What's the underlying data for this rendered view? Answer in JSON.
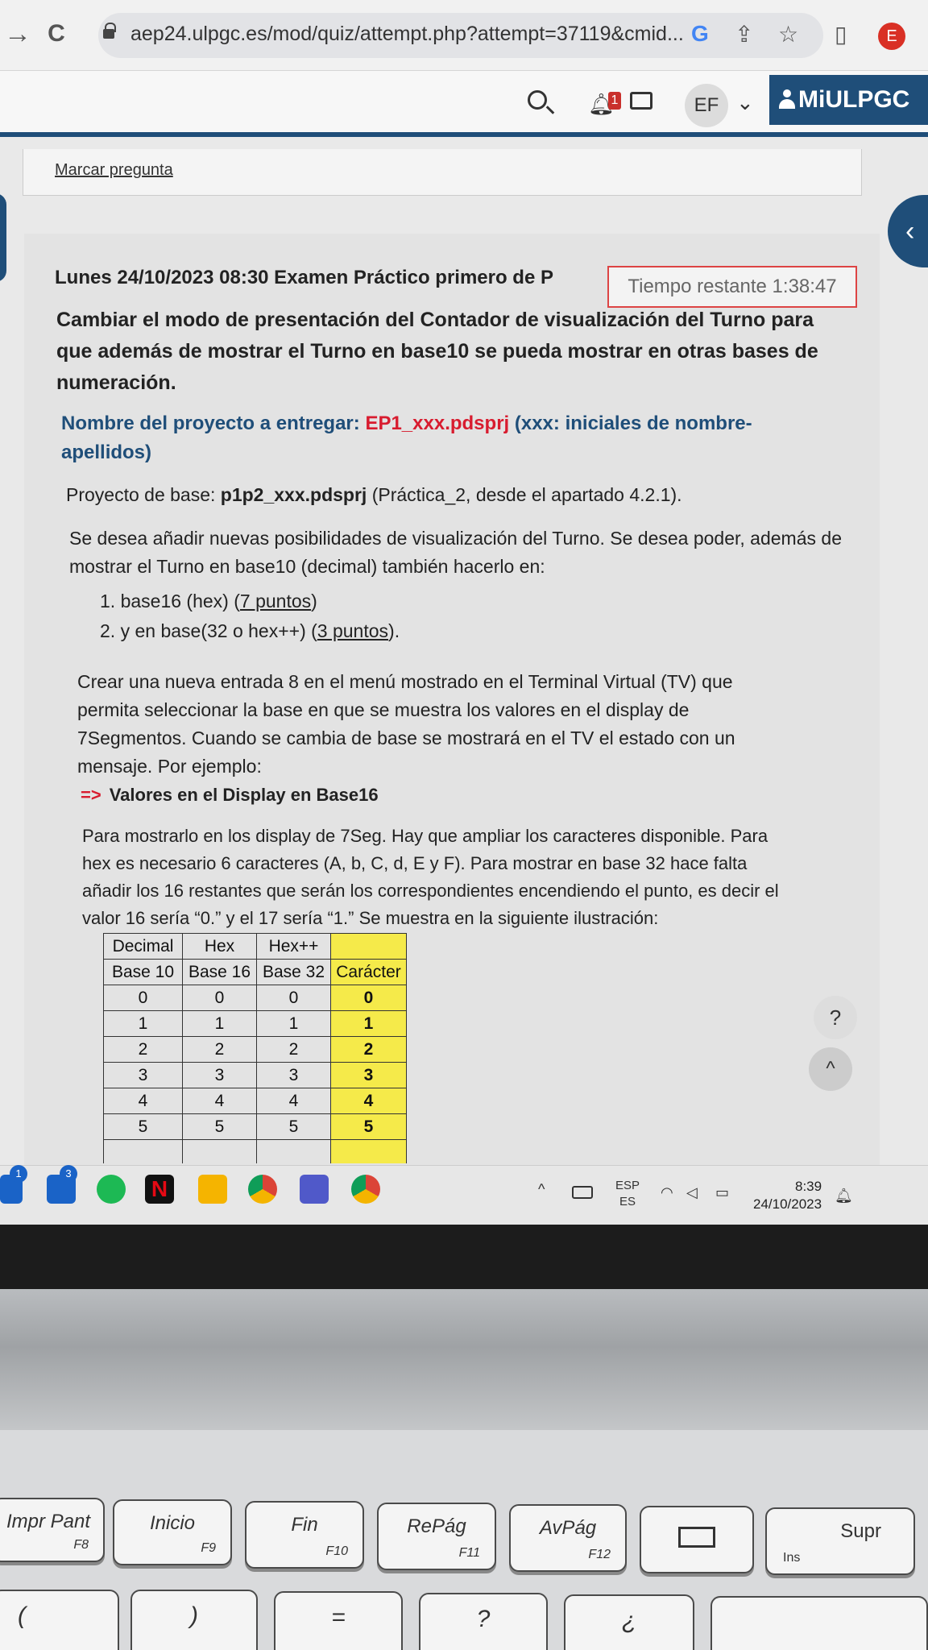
{
  "browser": {
    "back_glyph": "→",
    "reload_glyph": "C",
    "url": "aep24.ulpgc.es/mod/quiz/attempt.php?attempt=37119&cmid...",
    "google_glyph": "G",
    "share_glyph": "⇪",
    "star_glyph": "☆",
    "sidepanel_glyph": "▯",
    "profile_letter": "E"
  },
  "header": {
    "notification_count": "1",
    "user_initials": "EF",
    "user_chevron": "⌄",
    "miulpgc_label": "MiULPGC",
    "drawer_glyph": "‹"
  },
  "flag": {
    "label": "Marcar pregunta"
  },
  "question": {
    "exam_title": "Lunes 24/10/2023 08:30 Examen Práctico primero de P",
    "timer": "Tiempo restante 1:38:47",
    "task_title": "Cambiar el modo de presentación del Contador de visualización del Turno para que además de mostrar el Turno en base10 se pueda mostrar en otras bases de numeración.",
    "project_label": "Nombre del proyecto a entregar: ",
    "project_file": "EP1_xxx.pdsprj",
    "project_suffix": " (xxx: iniciales de nombre-apellidos)",
    "base_label": "Proyecto de base: ",
    "base_file": "p1p2_xxx.pdsprj",
    "base_suffix": " (Práctica_2, desde el apartado 4.2.1).",
    "intro": "Se desea añadir nuevas posibilidades de visualización del Turno. Se desea poder, además de mostrar el Turno en base10 (decimal) también hacerlo en:",
    "options": [
      {
        "num": "1.",
        "text": "base16 (hex) (",
        "points": "7 puntos",
        "end": ")"
      },
      {
        "num": "2.",
        "text": "y en base(32 o hex++) (",
        "points": "3 puntos",
        "end": ")."
      }
    ],
    "menu_text": "Crear una nueva entrada 8 en el menú mostrado en el Terminal Virtual (TV) que permita seleccionar la base en que se muestra los valores en el display de 7Segmentos. Cuando se cambia de base se mostrará en el TV el estado con un mensaje. Por ejemplo:",
    "status_arrow": "=>",
    "status_example": "Valores en el Display en Base16",
    "display_text": "Para mostrarlo en los display de 7Seg. Hay que ampliar los caracteres disponible. Para hex es necesario 6 caracteres (A, b, C, d, E y F). Para mostrar en base 32 hace falta añadir los 16 restantes que serán los correspondientes encendiendo el punto, es decir el valor 16 sería “0.” y el 17 sería “1.” Se muestra en la siguiente ilustración:"
  },
  "table": {
    "header1": [
      "Decimal",
      "Hex",
      "Hex++",
      ""
    ],
    "header2": [
      "Base 10",
      "Base 16",
      "Base 32",
      "Carácter"
    ],
    "rows": [
      [
        "0",
        "0",
        "0",
        "0"
      ],
      [
        "1",
        "1",
        "1",
        "1"
      ],
      [
        "2",
        "2",
        "2",
        "2"
      ],
      [
        "3",
        "3",
        "3",
        "3"
      ],
      [
        "4",
        "4",
        "4",
        "4"
      ],
      [
        "5",
        "5",
        "5",
        "5"
      ],
      [
        "",
        "",
        "",
        ""
      ]
    ]
  },
  "help": {
    "help_label": "?",
    "scroll_top_label": "^"
  },
  "taskbar": {
    "badges": [
      "1",
      "3"
    ],
    "lang_top": "ESP",
    "lang_bottom": "ES",
    "time": "8:39",
    "date": "24/10/2023",
    "colors": {
      "spotify": "#1db954",
      "netflix": "#e50914",
      "teams": "#5059c9",
      "chrome": "#db4437"
    }
  },
  "keyboard": {
    "keys": [
      {
        "main": "Impr Pant",
        "sub": "F8"
      },
      {
        "main": "Inicio",
        "sub": "F9"
      },
      {
        "main": "Fin",
        "sub": "F10"
      },
      {
        "main": "RePág",
        "sub": "F11"
      },
      {
        "main": "AvPág",
        "sub": "F12"
      },
      {
        "main": "",
        "sub": ""
      },
      {
        "main": "Supr",
        "sub": "Ins"
      }
    ],
    "row2": [
      "(",
      ")",
      "=",
      "?",
      "¿",
      ""
    ]
  }
}
